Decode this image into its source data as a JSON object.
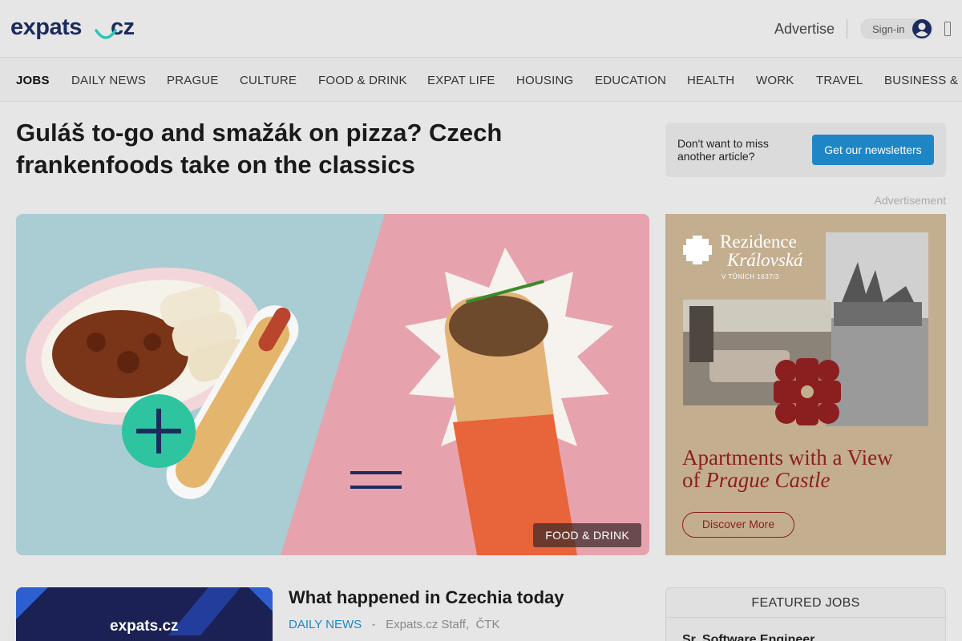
{
  "header": {
    "logo_main": "expats",
    "logo_tld": "cz",
    "advertise": "Advertise",
    "signin": "Sign-in",
    "icons": [
      "avatar-icon",
      "menu-icon"
    ]
  },
  "nav": {
    "items": [
      "JOBS",
      "DAILY NEWS",
      "PRAGUE",
      "CULTURE",
      "FOOD & DRINK",
      "EXPAT LIFE",
      "HOUSING",
      "EDUCATION",
      "HEALTH",
      "WORK",
      "TRAVEL",
      "BUSINESS & I"
    ]
  },
  "article": {
    "headline": "Guláš to-go and smažák on pizza? Czech frankenfoods take on the classics",
    "category_tag": "FOOD & DRINK"
  },
  "newsletter": {
    "text": "Don't want to miss another article?",
    "button": "Get our newsletters"
  },
  "ad": {
    "label": "Advertisement",
    "brand_line1": "Rezidence",
    "brand_line2": "Královská",
    "brand_line3": "V TŮNÍCH 1637/3",
    "headline_line1": "Apartments with a View",
    "headline_of": "of",
    "headline_italic": "Prague Castle",
    "button": "Discover More"
  },
  "next_article": {
    "thumb_logo": "expats.cz",
    "title": "What happened in Czechia today",
    "category": "DAILY NEWS",
    "separator": "-",
    "author": "Expats.cz Staff,",
    "source": "ČTK"
  },
  "featured_jobs": {
    "title": "FEATURED JOBS",
    "first_job": "Sr. Software Engineer"
  },
  "colors": {
    "brand_navy": "#1d2a5e",
    "brand_teal": "#2ec4b6",
    "link_blue": "#1f86c6",
    "ad_red": "#8b1e1e"
  }
}
